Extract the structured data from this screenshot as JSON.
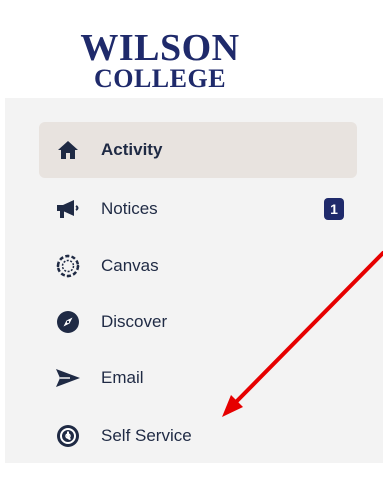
{
  "logo": {
    "line1": "WILSON",
    "line2": "COLLEGE"
  },
  "nav": {
    "items": [
      {
        "label": "Activity",
        "icon": "home-icon",
        "active": true
      },
      {
        "label": "Notices",
        "icon": "megaphone-icon",
        "badge": "1"
      },
      {
        "label": "Canvas",
        "icon": "canvas-icon"
      },
      {
        "label": "Discover",
        "icon": "compass-icon"
      },
      {
        "label": "Email",
        "icon": "send-icon"
      },
      {
        "label": "Self Service",
        "icon": "self-service-icon"
      }
    ]
  },
  "colors": {
    "brand": "#1f2a6b",
    "text": "#1f2a44",
    "active_bg": "#e8e3df",
    "panel_bg": "#f3f3f3",
    "arrow": "#e60000"
  }
}
